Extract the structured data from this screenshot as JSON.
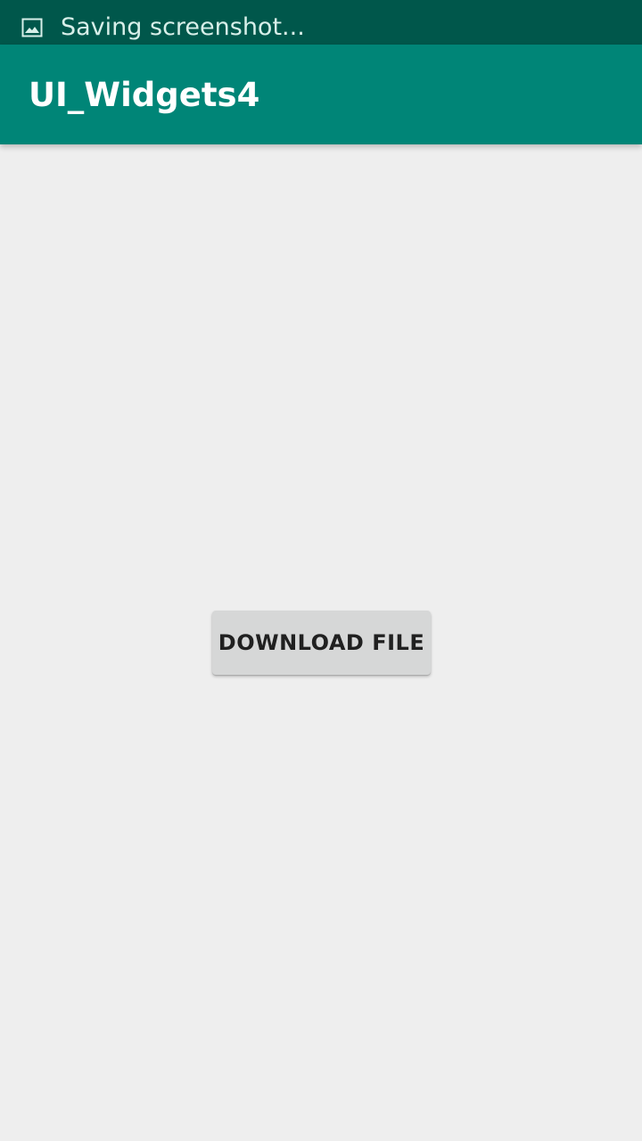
{
  "status_bar": {
    "icon": "image-icon",
    "notification_text": "Saving screenshot..."
  },
  "app_bar": {
    "title": "UI_Widgets4"
  },
  "main": {
    "download_button_label": "DOWNLOAD FILE"
  },
  "colors": {
    "status_bar": "#00574b",
    "app_bar": "#008577",
    "background": "#eeeeee",
    "button": "#d6d7d7",
    "button_text": "#202020",
    "title_text": "#ffffff"
  }
}
